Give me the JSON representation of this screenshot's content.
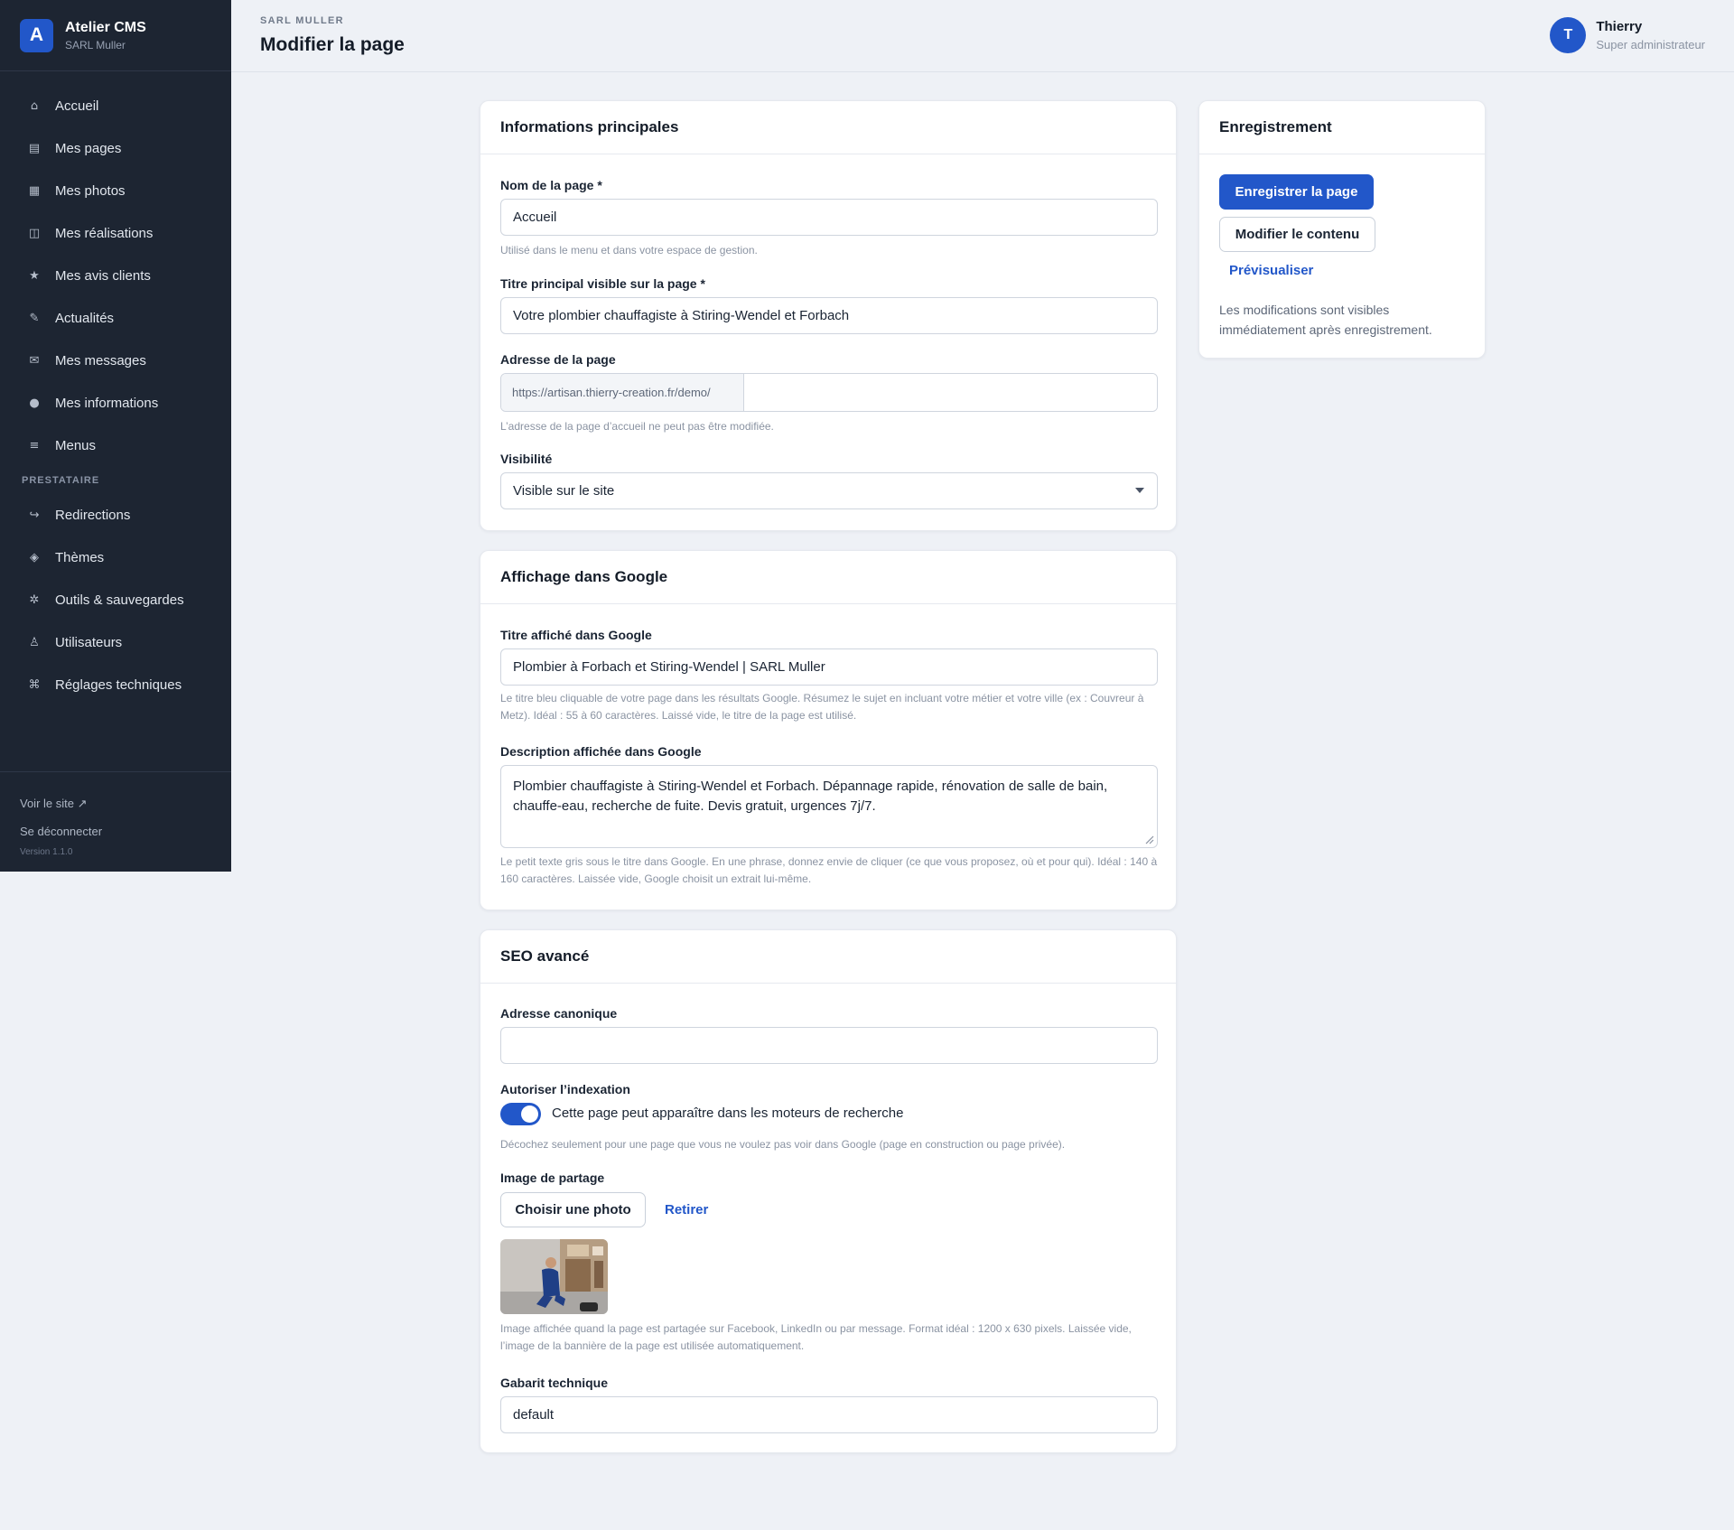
{
  "brand": {
    "initial": "A",
    "name": "Atelier CMS",
    "subtitle": "SARL Muller"
  },
  "sidebar": {
    "items": [
      {
        "icon": "home-icon",
        "glyph": "⌂",
        "label": "Accueil"
      },
      {
        "icon": "pages-icon",
        "glyph": "▤",
        "label": "Mes pages"
      },
      {
        "icon": "photos-icon",
        "glyph": "▦",
        "label": "Mes photos"
      },
      {
        "icon": "portfolio-icon",
        "glyph": "◫",
        "label": "Mes réalisations"
      },
      {
        "icon": "star-icon",
        "glyph": "★",
        "label": "Mes avis clients"
      },
      {
        "icon": "pencil-icon",
        "glyph": "✎",
        "label": "Actualités"
      },
      {
        "icon": "mail-icon",
        "glyph": "✉",
        "label": "Mes messages"
      },
      {
        "icon": "info-icon",
        "glyph": "●",
        "label": "Mes informations"
      },
      {
        "icon": "menu-icon",
        "glyph": "≡",
        "label": "Menus"
      }
    ],
    "section_label": "PRESTATAIRE",
    "provider_items": [
      {
        "icon": "redirect-icon",
        "glyph": "↪",
        "label": "Redirections"
      },
      {
        "icon": "theme-icon",
        "glyph": "◈",
        "label": "Thèmes"
      },
      {
        "icon": "tools-icon",
        "glyph": "✲",
        "label": "Outils & sauvegardes"
      },
      {
        "icon": "users-icon",
        "glyph": "♙",
        "label": "Utilisateurs"
      },
      {
        "icon": "settings-icon",
        "glyph": "⌘",
        "label": "Réglages techniques"
      }
    ],
    "view_site": "Voir le site ↗",
    "logout": "Se déconnecter",
    "version": "Version 1.1.0"
  },
  "header": {
    "org": "SARL MULLER",
    "title": "Modifier la page",
    "user_initial": "T",
    "user_name": "Thierry",
    "user_role": "Super administrateur"
  },
  "main_info": {
    "title": "Informations principales",
    "name_label": "Nom de la page *",
    "name_value": "Accueil",
    "name_help": "Utilisé dans le menu et dans votre espace de gestion.",
    "heading_label": "Titre principal visible sur la page *",
    "heading_value": "Votre plombier chauffagiste à Stiring-Wendel et Forbach",
    "address_label": "Adresse de la page",
    "address_prefix": "https://artisan.thierry-creation.fr/demo/",
    "address_value": "",
    "address_help": "L’adresse de la page d’accueil ne peut pas être modifiée.",
    "visibility_label": "Visibilité",
    "visibility_value": "Visible sur le site"
  },
  "google": {
    "title": "Affichage dans Google",
    "seo_title_label": "Titre affiché dans Google",
    "seo_title_value": "Plombier à Forbach et Stiring-Wendel | SARL Muller",
    "seo_title_help": "Le titre bleu cliquable de votre page dans les résultats Google. Résumez le sujet en incluant votre métier et votre ville (ex : Couvreur à Metz). Idéal : 55 à 60 caractères. Laissé vide, le titre de la page est utilisé.",
    "desc_label": "Description affichée dans Google",
    "desc_value": "Plombier chauffagiste à Stiring-Wendel et Forbach. Dépannage rapide, rénovation de salle de bain, chauffe-eau, recherche de fuite. Devis gratuit, urgences 7j/7.",
    "desc_help": "Le petit texte gris sous le titre dans Google. En une phrase, donnez envie de cliquer (ce que vous proposez, où et pour qui). Idéal : 140 à 160 caractères. Laissée vide, Google choisit un extrait lui-même."
  },
  "seo": {
    "title": "SEO avancé",
    "canonical_label": "Adresse canonique",
    "canonical_value": "",
    "index_label": "Autoriser l’indexation",
    "index_toggle_label": "Cette page peut apparaître dans les moteurs de recherche",
    "index_enabled": true,
    "index_help": "Décochez seulement pour une page que vous ne voulez pas voir dans Google (page en construction ou page privée).",
    "share_label": "Image de partage",
    "choose_photo": "Choisir une photo",
    "remove": "Retirer",
    "share_help": "Image affichée quand la page est partagée sur Facebook, LinkedIn ou par message. Format idéal : 1200 x 630 pixels. Laissée vide, l’image de la bannière de la page est utilisée automatiquement.",
    "template_label": "Gabarit technique",
    "template_value": "default"
  },
  "save_panel": {
    "title": "Enregistrement",
    "save_button": "Enregistrer la page",
    "edit_content_button": "Modifier le contenu",
    "preview_link": "Prévisualiser",
    "note": "Les modifications sont visibles immédiatement après enregistrement."
  },
  "colors": {
    "accent": "#2257c9",
    "sidebar_bg": "#1d2532",
    "page_bg": "#eef1f6"
  }
}
